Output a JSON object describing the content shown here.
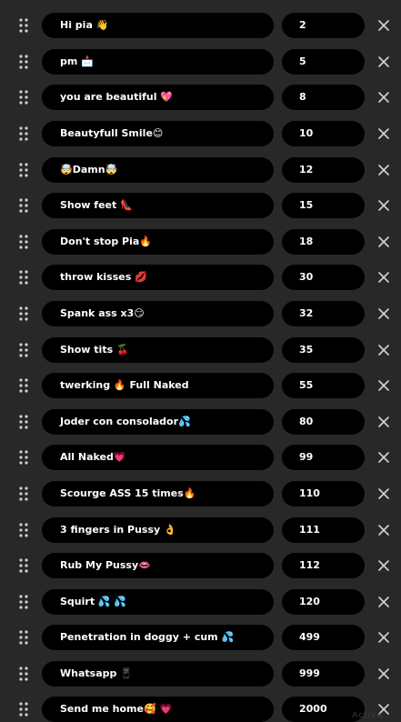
{
  "tip_menu": {
    "items": [
      {
        "label": "Hi pia 👋",
        "amount": "2"
      },
      {
        "label": "pm 📩",
        "amount": "5"
      },
      {
        "label": "you are beautiful 💖",
        "amount": "8"
      },
      {
        "label": "Beautyfull Smile😊",
        "amount": "10"
      },
      {
        "label": "🤯Damn🤯",
        "amount": "12"
      },
      {
        "label": "Show feet 👠",
        "amount": "15"
      },
      {
        "label": "Don't stop Pia🔥",
        "amount": "18"
      },
      {
        "label": "throw kisses 💋",
        "amount": "30"
      },
      {
        "label": "Spank ass x3😏",
        "amount": "32"
      },
      {
        "label": "Show tits 🍒",
        "amount": "35"
      },
      {
        "label": "twerking 🔥 Full Naked",
        "amount": "55"
      },
      {
        "label": "Joder con consolador💦",
        "amount": "80"
      },
      {
        "label": "All Naked💗",
        "amount": "99"
      },
      {
        "label": "Scourge ASS 15 times🔥",
        "amount": "110"
      },
      {
        "label": "3 fingers in Pussy 👌",
        "amount": "111"
      },
      {
        "label": "Rub My Pussy👄",
        "amount": "112"
      },
      {
        "label": "Squirt 💦 💦",
        "amount": "120"
      },
      {
        "label": "Penetration in doggy + cum 💦",
        "amount": "499"
      },
      {
        "label": "Whatsapp 📱",
        "amount": "999"
      },
      {
        "label": "Send me home🥰 💗",
        "amount": "2000"
      }
    ]
  },
  "watermark": "Activa",
  "icons": {
    "drag": "drag-handle-icon",
    "remove": "close-icon"
  },
  "colors": {
    "background": "#282828",
    "pill": "#000000",
    "text": "#ffffff",
    "icon": "#d0d0d0"
  }
}
